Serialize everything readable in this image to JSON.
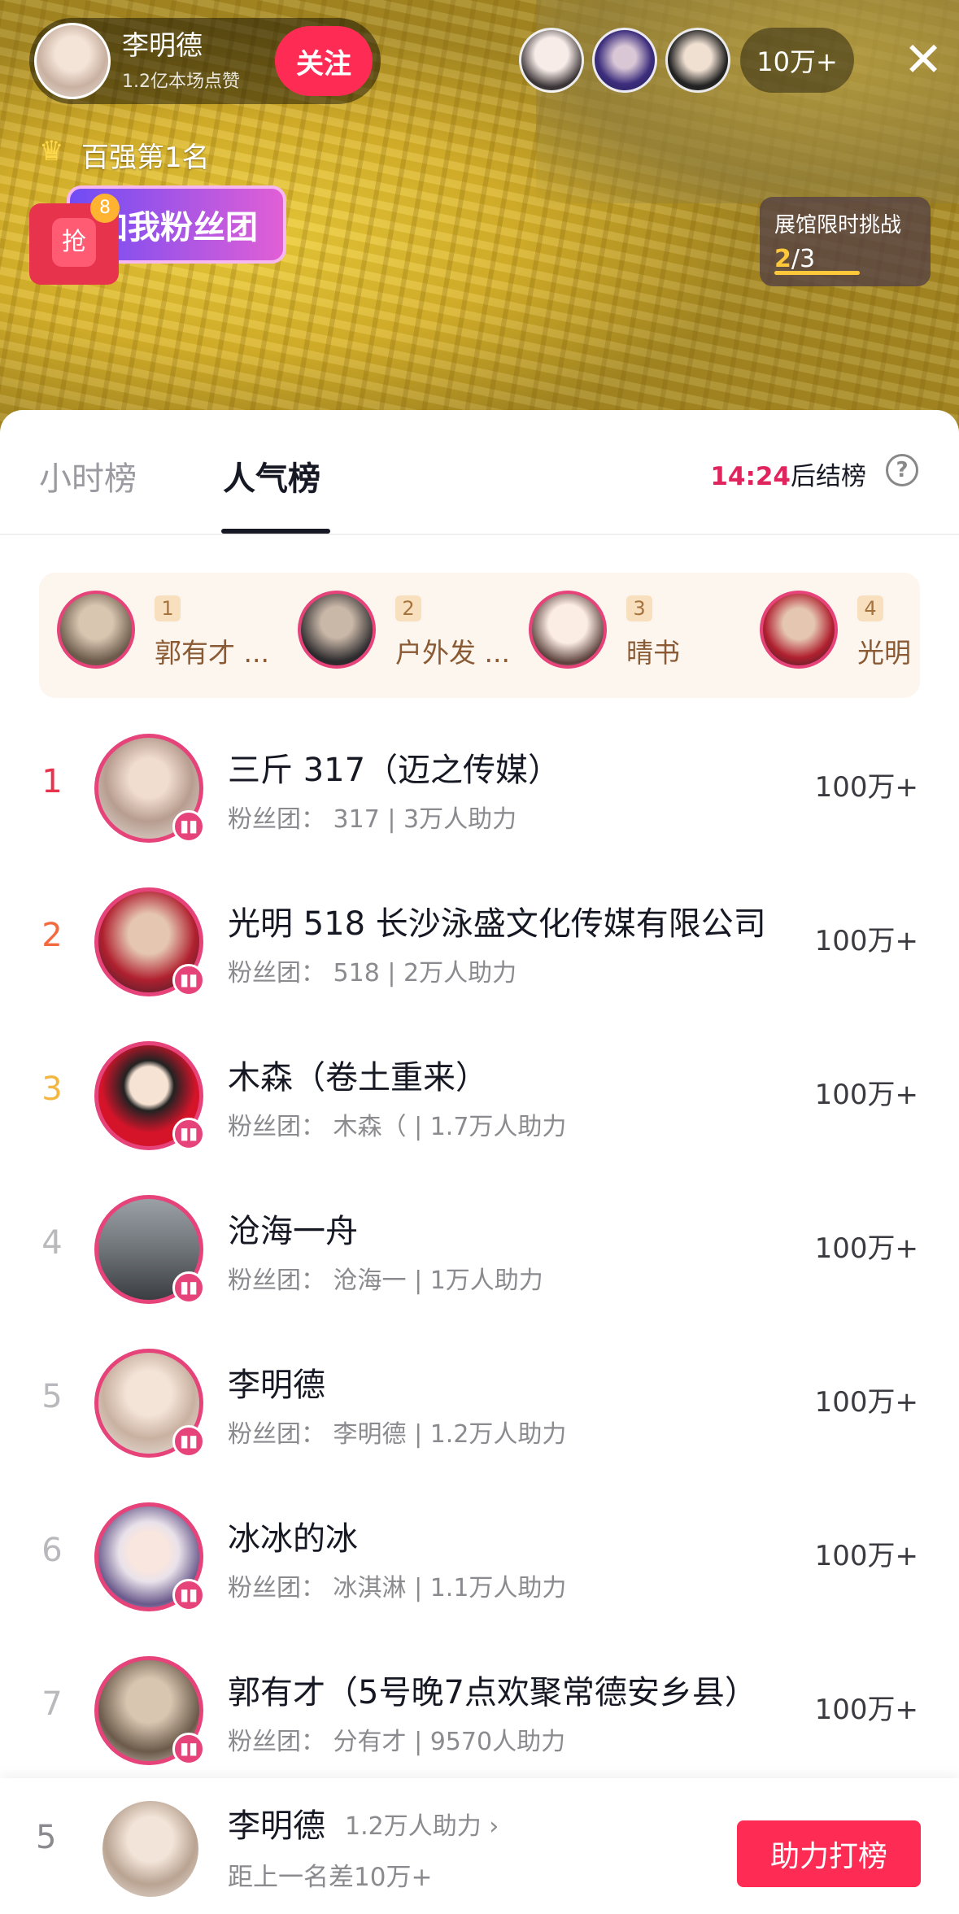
{
  "anchor": {
    "name": "李明德",
    "likes": "1.2亿本场点赞",
    "follow_label": "关注"
  },
  "viewers": {
    "count": "10万+"
  },
  "close_icon": "✕",
  "badges": {
    "rank_text": "百强第1名",
    "fan_group_label": "加我粉丝团",
    "redpack_label": "抢",
    "redpack_count": "8"
  },
  "challenge": {
    "title": "展馆限时挑战",
    "current": "2",
    "total": "/3",
    "progress": 0.67
  },
  "tabs": [
    {
      "label": "小时榜",
      "active": false
    },
    {
      "label": "人气榜",
      "active": true
    }
  ],
  "countdown": {
    "time": "14:24",
    "suffix": "后结榜"
  },
  "help_icon": "?",
  "top_strip": [
    {
      "num": "1",
      "name": "郭有才 ..."
    },
    {
      "num": "2",
      "name": "户外发 ..."
    },
    {
      "num": "3",
      "name": "晴书"
    },
    {
      "num": "4",
      "name": "光明"
    }
  ],
  "ranking": [
    {
      "rank": "1",
      "name": "三斤 317（迈之传媒）",
      "sub": "粉丝团：  317 | 3万人助力",
      "score": "100万+"
    },
    {
      "rank": "2",
      "name": "光明 518 长沙泳盛文化传媒有限公司",
      "sub": "粉丝团：  518 | 2万人助力",
      "score": "100万+"
    },
    {
      "rank": "3",
      "name": "木森（卷土重来）",
      "sub": "粉丝团：  木森（ | 1.7万人助力",
      "score": "100万+"
    },
    {
      "rank": "4",
      "name": "沧海一舟",
      "sub": "粉丝团：  沧海一 | 1万人助力",
      "score": "100万+"
    },
    {
      "rank": "5",
      "name": "李明德",
      "sub": "粉丝团：  李明德 | 1.2万人助力",
      "score": "100万+"
    },
    {
      "rank": "6",
      "name": "冰冰的冰",
      "sub": "粉丝团：  冰淇淋 | 1.1万人助力",
      "score": "100万+"
    },
    {
      "rank": "7",
      "name": "郭有才（5号晚7点欢聚常德安乡县）",
      "sub": "粉丝团：  分有才 | 9570人助力",
      "score": "100万+"
    }
  ],
  "my": {
    "rank": "5",
    "name": "李明德",
    "support": "1.2万人助力 ›",
    "gap": "距上一名差10万+",
    "boost_label": "助力打榜"
  },
  "colors": {
    "accent": "#fe2c55",
    "rank1": "#e8334d",
    "rank2": "#f46a3e",
    "rank3": "#f3b640",
    "avatar_ring": "#e6437a"
  }
}
